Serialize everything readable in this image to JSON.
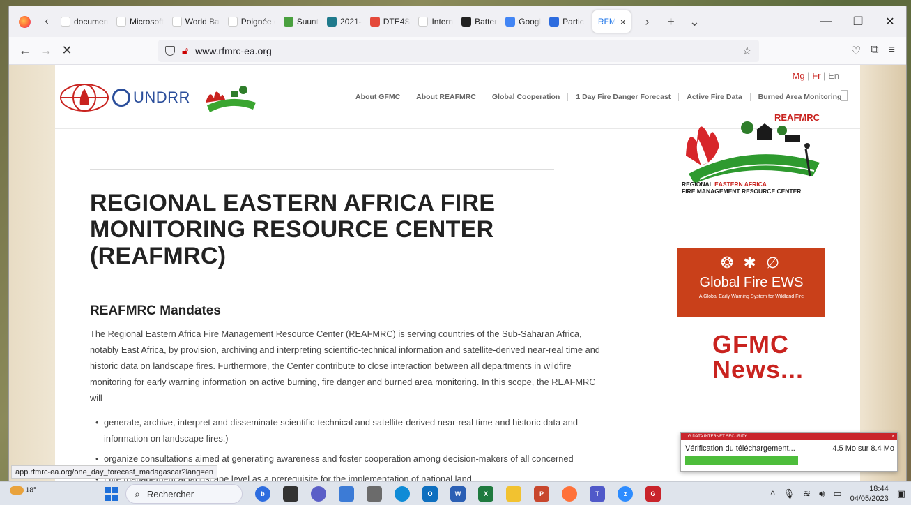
{
  "browser": {
    "tabs": [
      {
        "label": "document",
        "color": "#ffffff"
      },
      {
        "label": "Microsoft",
        "color": "#ffffff"
      },
      {
        "label": "World Ban",
        "color": "#ffffff"
      },
      {
        "label": "Poignée d",
        "color": "#ffffff"
      },
      {
        "label": "Suunt",
        "color": "#4aa03f"
      },
      {
        "label": "2021-",
        "color": "#1f7a8c"
      },
      {
        "label": "DTE4S",
        "color": "#e4493a"
      },
      {
        "label": "Intern",
        "color": "#ffffff"
      },
      {
        "label": "Batter",
        "color": "#222222"
      },
      {
        "label": "Googl",
        "color": "#4285f4"
      },
      {
        "label": "Partic",
        "color": "#2d6cdf"
      }
    ],
    "active_tab": {
      "label": "RFM",
      "close": "×"
    },
    "new_tab": "+",
    "tab_list": "⌄",
    "url": "www.rfmrc-ea.org",
    "win_controls": {
      "minimize": "—",
      "restore": "❐",
      "close": "✕"
    }
  },
  "site": {
    "lang": {
      "mg": "Mg",
      "sep1": " | ",
      "fr": "Fr",
      "sep2": " | ",
      "en": "En"
    },
    "logo_text": "UNDRR",
    "reaf_small_label": "REAFMRC",
    "nav": [
      "About GFMC",
      "About REAFMRC",
      "Global Cooperation",
      "1 Day Fire Danger Forecast",
      "Active Fire Data",
      "Burned Area Monitoring"
    ],
    "title": "REGIONAL EASTERN AFRICA FIRE MONITORING RESOURCE CENTER (REAFMRC)",
    "subtitle": "REAFMRC Mandates",
    "body": "The Regional Eastern Africa Fire Management Resource Center (REAFMRC) is serving countries of the Sub-Saharan Africa, notably East Africa, by provision, archiving and interpreting scientific-technical information and satellite-derived near-real time and historic data on landscape fires. Furthermore, the Center contribute to close interaction between all departments in wildfire monitoring for early warning information on active burning, fire danger and burned area monitoring. In this scope, the REAFMRC will",
    "mandates": [
      "generate, archive, interpret and disseminate scientific-technical and satellite-derived near-real time and historic data and information on landscape fires.)",
      "organize consultations aimed at generating awareness and foster cooperation among decision-makers of all concerned",
      "f fire management at landscape level as a prerequisite for the implementation of national land"
    ],
    "sidebar": {
      "reaf_brand": "REAFMRC",
      "reaf_caption_1a": "REGIONAL ",
      "reaf_caption_1b": "EASTERN AFRICA",
      "reaf_caption_2": "FIRE MANAGEMENT RESOURCE CENTER",
      "ews_icons": "❂ ✱ ∅",
      "ews_title": "Global Fire EWS",
      "ews_sub": "A Global Early Warning System for Wildland Fire",
      "news": "GFMC News..."
    }
  },
  "status_url": "app.rfmrc-ea.org/one_day_forecast_madagascar?lang=en",
  "av_popup": {
    "header": "G DATA INTERNET SECURITY",
    "close": "×",
    "status": "Vérification du téléchargement...",
    "progress_text": "4.5 Mo sur 8.4 Mo",
    "progress_fraction": 0.54
  },
  "taskbar": {
    "temperature": "18°",
    "search_placeholder": "Rechercher",
    "time": "18:44",
    "date": "04/05/2023"
  },
  "colors": {
    "accent_red": "#c9231f",
    "undrr_blue": "#2b4e9b",
    "ews_orange": "#c9401a",
    "av_green": "#4dbd3b"
  }
}
